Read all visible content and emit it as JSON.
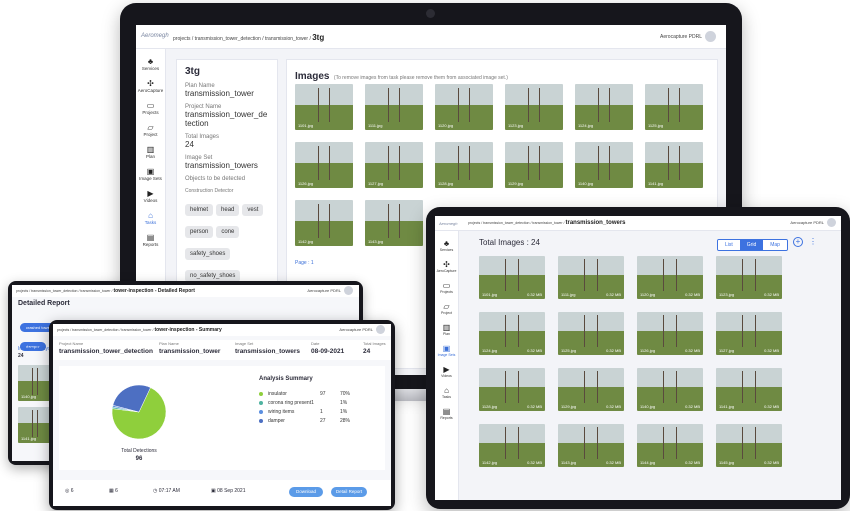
{
  "laptop": {
    "logo": "Aeromegh",
    "breadcrumb": "projects / transmission_tower_detection / transmission_tower /",
    "breadcrumb_current": "3tg",
    "user": "Aerocapture PDRL",
    "sidebar": [
      "Services",
      "AeroCapture",
      "Projects",
      "Project",
      "Plan",
      "Image Sets",
      "Videos",
      "Tasks",
      "Reports"
    ],
    "task_title": "3tg",
    "plan_label": "Plan Name",
    "plan_value": "transmission_tower",
    "project_label": "Project Name",
    "project_value": "transmission_tower_detection",
    "total_label": "Total Images",
    "total_value": "24",
    "imageset_label": "Image Set",
    "imageset_value": "transmission_towers",
    "objects_label": "Objects to be detected",
    "detector_label": "Construction Detector",
    "chips": [
      "helmet",
      "head",
      "vest",
      "person",
      "cone",
      "safety_shoes",
      "no_safety_shoes",
      "gloves"
    ],
    "images_title": "Images",
    "images_note": "(To remove images from task please remove them from associated image set.)",
    "thumbs": [
      "1101.jpg",
      "1111.jpg",
      "1120.jpg",
      "1123.jpg",
      "1124.jpg",
      "1125.jpg",
      "1126.jpg",
      "1127.jpg",
      "1128.jpg",
      "1129.jpg",
      "1140.jpg",
      "1141.jpg",
      "1142.jpg",
      "1143.jpg"
    ],
    "page": "Page : 1"
  },
  "report": {
    "breadcrumb": "projects / transmission_tower_detection / transmission_tower /",
    "breadcrumb_current": "tower-inspection - Detailed Report",
    "user": "Aerocapture PDRL",
    "title": "Detailed Report",
    "tags": [
      "crashed tower",
      "isolated bolt",
      "insulator",
      "nut bolt",
      "corrosion",
      "corona ring present",
      "corona ring missing",
      "no bolts",
      "damper"
    ],
    "images_analysed": "Images Analyse",
    "images_count": "24",
    "thumbs": [
      "1140.jpg",
      "1141.jpg"
    ]
  },
  "summary": {
    "breadcrumb": "projects / transmission_tower_detection / transmission_tower /",
    "breadcrumb_current": "tower-inspection - Summary",
    "user": "Aerocapture PDRL",
    "fields": [
      {
        "label": "Project Name",
        "value": "transmission_tower_detection"
      },
      {
        "label": "Plan Name",
        "value": "transmission_tower"
      },
      {
        "label": "Image Set",
        "value": "transmission_towers"
      },
      {
        "label": "Date",
        "value": "08-09-2021"
      },
      {
        "label": "Total Images",
        "value": "24"
      }
    ],
    "analysis_title": "Analysis Summary",
    "analysis": [
      {
        "name": "insulator",
        "count": "97",
        "pct": "70%",
        "color": "#8fcf3c"
      },
      {
        "name": "corona ring present1",
        "count": "",
        "pct": "1%",
        "color": "#4fb3a0"
      },
      {
        "name": "wiring items",
        "count": "1",
        "pct": "1%",
        "color": "#5b8fe0"
      },
      {
        "name": "damper",
        "count": "27",
        "pct": "28%",
        "color": "#4d6fc2"
      }
    ],
    "pie_label": "Total Detections",
    "pie_total": "96",
    "footer": [
      "6",
      "6",
      "07:17 AM",
      "08 Sep 2021"
    ],
    "download": "Download",
    "detail": "Detail Report"
  },
  "tablet": {
    "logo": "Aeromegh",
    "breadcrumb": "projects / transmission_tower_detection / transmission_tower /",
    "breadcrumb_current": "transmission_towers",
    "user": "Aerocapture PDRL",
    "sidebar": [
      "Services",
      "AeroCapture",
      "Projects",
      "Project",
      "Plan",
      "Image Sets",
      "Videos",
      "Tasks",
      "Reports"
    ],
    "total": "Total Images : 24",
    "tabs": [
      "List",
      "Grid",
      "Map"
    ],
    "thumbs": [
      "1101.jpg",
      "1111.jpg",
      "1120.jpg",
      "1123.jpg",
      "1124.jpg",
      "1125.jpg",
      "1126.jpg",
      "1127.jpg",
      "1128.jpg",
      "1129.jpg",
      "1140.jpg",
      "1141.jpg",
      "1142.jpg",
      "1143.jpg",
      "1144.jpg",
      "1145.jpg"
    ],
    "thumb_size": "0.32 MB"
  },
  "colors": {
    "accent": "#3d72e0",
    "pie_main": "#8fcf3c",
    "pie_alt": "#4d6fc2"
  }
}
